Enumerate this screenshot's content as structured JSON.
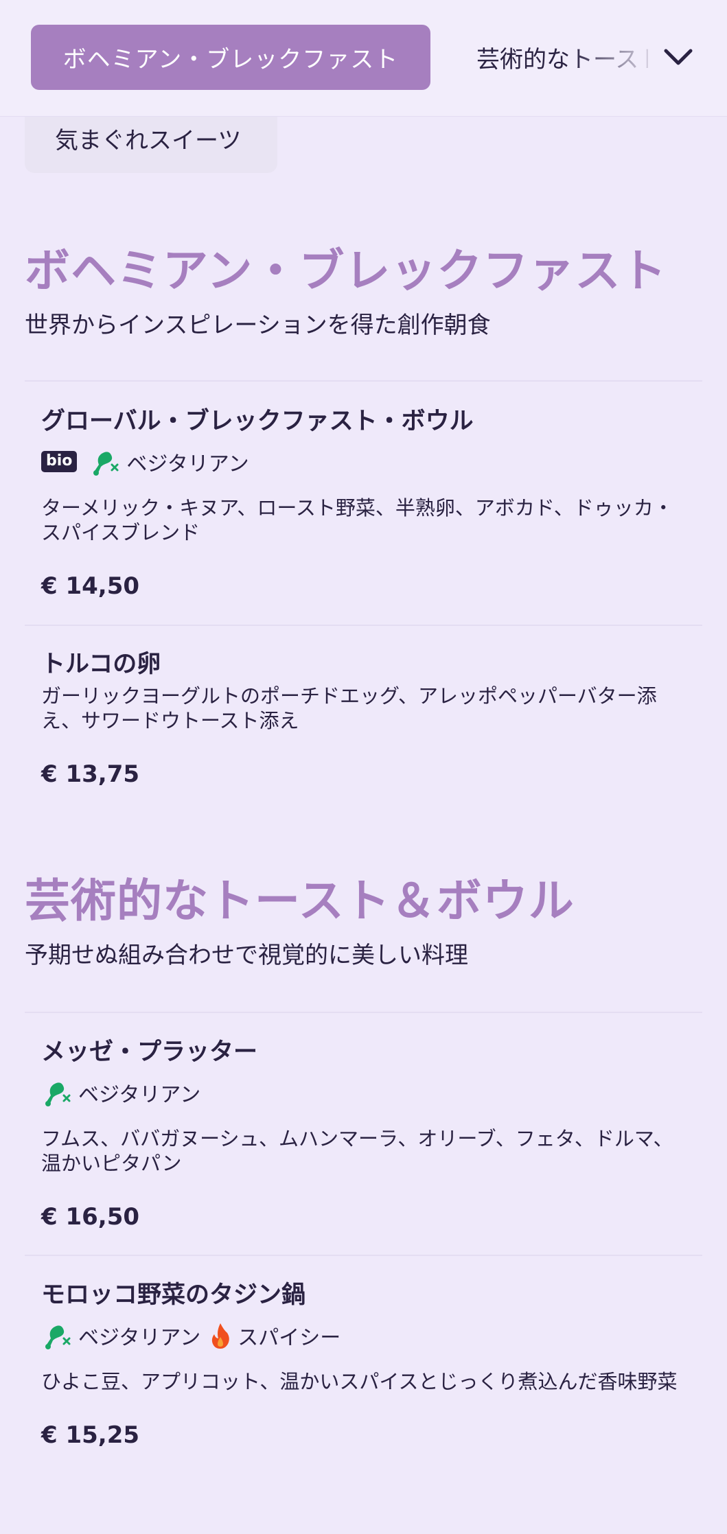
{
  "nav": {
    "active_tab": "ボヘミアン・ブレックファスト",
    "next_tab": "芸術的なトースト",
    "prev_tab": "気まぐれスイーツ"
  },
  "sections": [
    {
      "title": "ボヘミアン・ブレックファスト",
      "subtitle": "世界からインスピレーションを得た創作朝食",
      "items": [
        {
          "name": "グローバル・ブレックファスト・ボウル",
          "tags": [
            "bio",
            "ベジタリアン"
          ],
          "description": "ターメリック・キヌア、ロースト野菜、半熟卵、アボカド、ドゥッカ・スパイスブレンド",
          "price": "€ 14,50"
        },
        {
          "name": "トルコの卵",
          "tags": [],
          "description": "ガーリックヨーグルトのポーチドエッグ、アレッポペッパーバター添え、サワードウトースト添え",
          "price": "€ 13,75"
        }
      ]
    },
    {
      "title": "芸術的なトースト＆ボウル",
      "subtitle": "予期せぬ組み合わせで視覚的に美しい料理",
      "items": [
        {
          "name": "メッゼ・プラッター",
          "tags": [
            "ベジタリアン"
          ],
          "description": "フムス、ババガヌーシュ、ムハンマーラ、オリーブ、フェタ、ドルマ、温かいピタパン",
          "price": "€ 16,50"
        },
        {
          "name": "モロッコ野菜のタジン鍋",
          "tags": [
            "ベジタリアン",
            "スパイシー"
          ],
          "description": "ひよこ豆、アプリコット、温かいスパイスとじっくり煮込んだ香味野菜",
          "price": "€ 15,25"
        }
      ]
    }
  ],
  "icons": {
    "vegetarian": "meat-crossed-icon",
    "spicy": "flame-icon",
    "dropdown": "chevron-down-icon"
  },
  "colors": {
    "accent": "#a67fbf",
    "background": "#efe9fa",
    "text": "#2a2242",
    "vegetarian": "#1aa866",
    "spicy": "#f0501e"
  }
}
